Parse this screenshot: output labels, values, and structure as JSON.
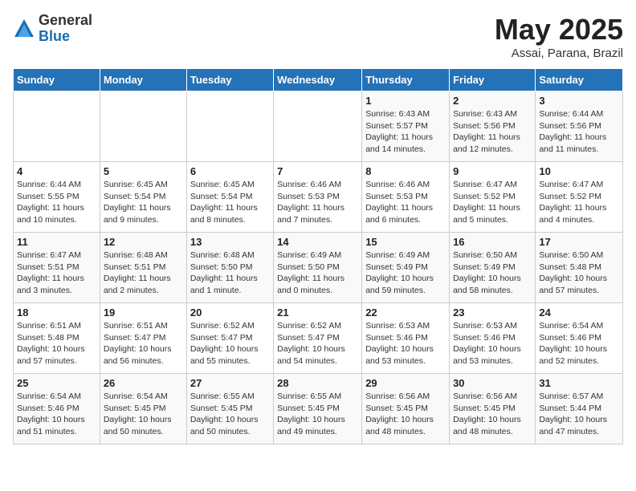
{
  "header": {
    "logo_general": "General",
    "logo_blue": "Blue",
    "month": "May 2025",
    "location": "Assai, Parana, Brazil"
  },
  "weekdays": [
    "Sunday",
    "Monday",
    "Tuesday",
    "Wednesday",
    "Thursday",
    "Friday",
    "Saturday"
  ],
  "weeks": [
    [
      {
        "day": "",
        "info": ""
      },
      {
        "day": "",
        "info": ""
      },
      {
        "day": "",
        "info": ""
      },
      {
        "day": "",
        "info": ""
      },
      {
        "day": "1",
        "info": "Sunrise: 6:43 AM\nSunset: 5:57 PM\nDaylight: 11 hours and 14 minutes."
      },
      {
        "day": "2",
        "info": "Sunrise: 6:43 AM\nSunset: 5:56 PM\nDaylight: 11 hours and 12 minutes."
      },
      {
        "day": "3",
        "info": "Sunrise: 6:44 AM\nSunset: 5:56 PM\nDaylight: 11 hours and 11 minutes."
      }
    ],
    [
      {
        "day": "4",
        "info": "Sunrise: 6:44 AM\nSunset: 5:55 PM\nDaylight: 11 hours and 10 minutes."
      },
      {
        "day": "5",
        "info": "Sunrise: 6:45 AM\nSunset: 5:54 PM\nDaylight: 11 hours and 9 minutes."
      },
      {
        "day": "6",
        "info": "Sunrise: 6:45 AM\nSunset: 5:54 PM\nDaylight: 11 hours and 8 minutes."
      },
      {
        "day": "7",
        "info": "Sunrise: 6:46 AM\nSunset: 5:53 PM\nDaylight: 11 hours and 7 minutes."
      },
      {
        "day": "8",
        "info": "Sunrise: 6:46 AM\nSunset: 5:53 PM\nDaylight: 11 hours and 6 minutes."
      },
      {
        "day": "9",
        "info": "Sunrise: 6:47 AM\nSunset: 5:52 PM\nDaylight: 11 hours and 5 minutes."
      },
      {
        "day": "10",
        "info": "Sunrise: 6:47 AM\nSunset: 5:52 PM\nDaylight: 11 hours and 4 minutes."
      }
    ],
    [
      {
        "day": "11",
        "info": "Sunrise: 6:47 AM\nSunset: 5:51 PM\nDaylight: 11 hours and 3 minutes."
      },
      {
        "day": "12",
        "info": "Sunrise: 6:48 AM\nSunset: 5:51 PM\nDaylight: 11 hours and 2 minutes."
      },
      {
        "day": "13",
        "info": "Sunrise: 6:48 AM\nSunset: 5:50 PM\nDaylight: 11 hours and 1 minute."
      },
      {
        "day": "14",
        "info": "Sunrise: 6:49 AM\nSunset: 5:50 PM\nDaylight: 11 hours and 0 minutes."
      },
      {
        "day": "15",
        "info": "Sunrise: 6:49 AM\nSunset: 5:49 PM\nDaylight: 10 hours and 59 minutes."
      },
      {
        "day": "16",
        "info": "Sunrise: 6:50 AM\nSunset: 5:49 PM\nDaylight: 10 hours and 58 minutes."
      },
      {
        "day": "17",
        "info": "Sunrise: 6:50 AM\nSunset: 5:48 PM\nDaylight: 10 hours and 57 minutes."
      }
    ],
    [
      {
        "day": "18",
        "info": "Sunrise: 6:51 AM\nSunset: 5:48 PM\nDaylight: 10 hours and 57 minutes."
      },
      {
        "day": "19",
        "info": "Sunrise: 6:51 AM\nSunset: 5:47 PM\nDaylight: 10 hours and 56 minutes."
      },
      {
        "day": "20",
        "info": "Sunrise: 6:52 AM\nSunset: 5:47 PM\nDaylight: 10 hours and 55 minutes."
      },
      {
        "day": "21",
        "info": "Sunrise: 6:52 AM\nSunset: 5:47 PM\nDaylight: 10 hours and 54 minutes."
      },
      {
        "day": "22",
        "info": "Sunrise: 6:53 AM\nSunset: 5:46 PM\nDaylight: 10 hours and 53 minutes."
      },
      {
        "day": "23",
        "info": "Sunrise: 6:53 AM\nSunset: 5:46 PM\nDaylight: 10 hours and 53 minutes."
      },
      {
        "day": "24",
        "info": "Sunrise: 6:54 AM\nSunset: 5:46 PM\nDaylight: 10 hours and 52 minutes."
      }
    ],
    [
      {
        "day": "25",
        "info": "Sunrise: 6:54 AM\nSunset: 5:46 PM\nDaylight: 10 hours and 51 minutes."
      },
      {
        "day": "26",
        "info": "Sunrise: 6:54 AM\nSunset: 5:45 PM\nDaylight: 10 hours and 50 minutes."
      },
      {
        "day": "27",
        "info": "Sunrise: 6:55 AM\nSunset: 5:45 PM\nDaylight: 10 hours and 50 minutes."
      },
      {
        "day": "28",
        "info": "Sunrise: 6:55 AM\nSunset: 5:45 PM\nDaylight: 10 hours and 49 minutes."
      },
      {
        "day": "29",
        "info": "Sunrise: 6:56 AM\nSunset: 5:45 PM\nDaylight: 10 hours and 48 minutes."
      },
      {
        "day": "30",
        "info": "Sunrise: 6:56 AM\nSunset: 5:45 PM\nDaylight: 10 hours and 48 minutes."
      },
      {
        "day": "31",
        "info": "Sunrise: 6:57 AM\nSunset: 5:44 PM\nDaylight: 10 hours and 47 minutes."
      }
    ]
  ]
}
